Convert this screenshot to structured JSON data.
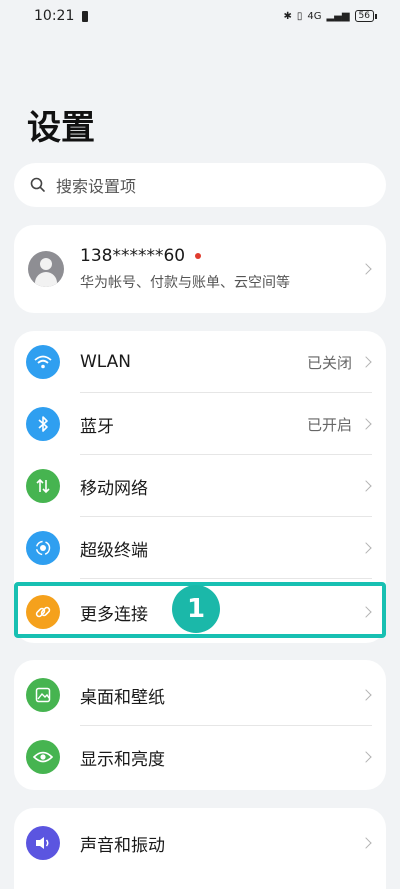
{
  "status_bar": {
    "time": "10:21",
    "battery": "56",
    "network": "4G"
  },
  "page": {
    "title": "设置"
  },
  "search": {
    "placeholder": "搜索设置项"
  },
  "account": {
    "name": "138******60",
    "subtitle": "华为帐号、付款与账单、云空间等"
  },
  "connectivity": {
    "items": [
      {
        "label": "WLAN",
        "value": "已关闭",
        "icon": "wifi-icon",
        "color": "#2f9ff0"
      },
      {
        "label": "蓝牙",
        "value": "已开启",
        "icon": "bluetooth-icon",
        "color": "#2f9ff0"
      },
      {
        "label": "移动网络",
        "value": "",
        "icon": "mobile-data-icon",
        "color": "#46b450"
      },
      {
        "label": "超级终端",
        "value": "",
        "icon": "super-device-icon",
        "color": "#2f9ff0"
      },
      {
        "label": "更多连接",
        "value": "",
        "icon": "link-icon",
        "color": "#f5a11c"
      }
    ]
  },
  "display": {
    "items": [
      {
        "label": "桌面和壁纸",
        "icon": "wallpaper-icon",
        "color": "#46b450"
      },
      {
        "label": "显示和亮度",
        "icon": "eye-icon",
        "color": "#46b450"
      }
    ]
  },
  "sound": {
    "items": [
      {
        "label": "声音和振动",
        "icon": "speaker-icon",
        "color": "#5b55e0"
      }
    ]
  },
  "annotation": {
    "step": "1",
    "highlight_color": "#18c0b2"
  }
}
